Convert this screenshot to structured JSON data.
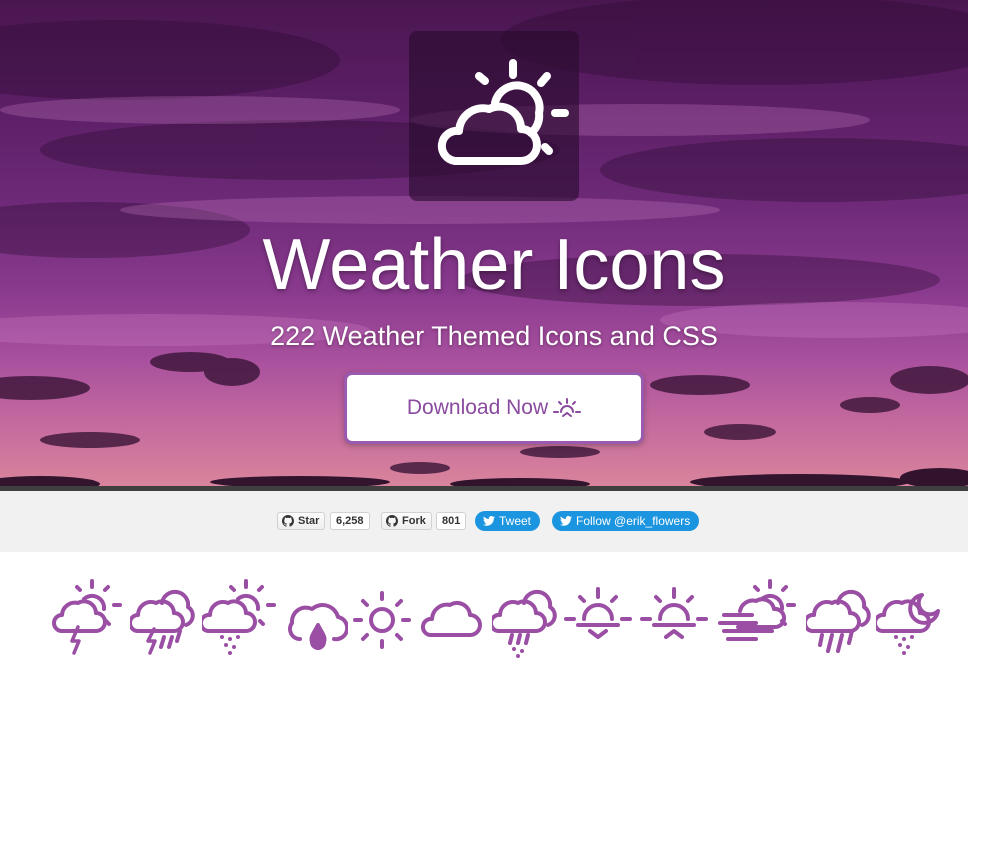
{
  "hero": {
    "logo_icon": "day-cloudy-icon",
    "title": "Weather Icons",
    "subtitle": "222 Weather Themed Icons and CSS",
    "download_label": "Download Now",
    "download_icon": "sunrise-icon",
    "accent_color": "#8a4a9e"
  },
  "social": {
    "star_label": "Star",
    "star_count": "6,258",
    "fork_label": "Fork",
    "fork_count": "801",
    "tweet_label": "Tweet",
    "follow_label": "Follow @erik_flowers",
    "twitter_color": "#1b95e0"
  },
  "icon_row": {
    "color": "#9a4fa4",
    "icons": [
      "day-thunderstorm-icon",
      "storm-showers-icon",
      "day-snow-icon",
      "raindrop-cloud-icon",
      "sun-icon",
      "cloud-icon",
      "rain-mix-icon",
      "sunrise-icon",
      "sunset-icon",
      "day-fog-icon",
      "showers-icon",
      "night-snow-icon"
    ]
  }
}
